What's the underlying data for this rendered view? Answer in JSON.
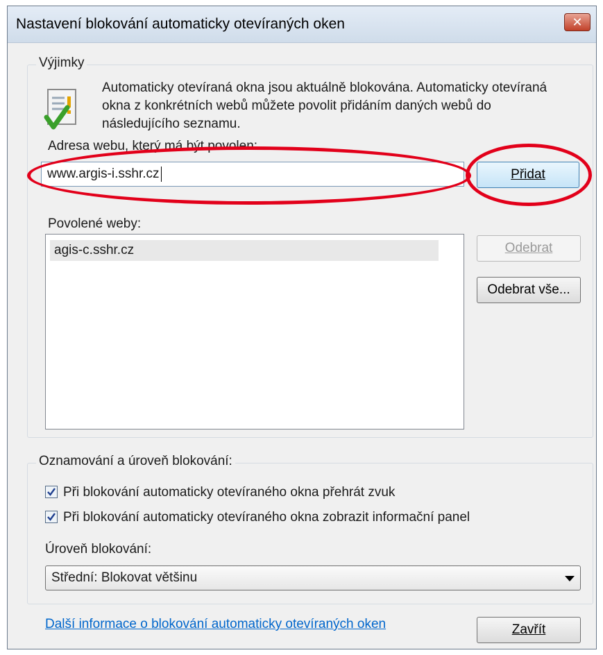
{
  "window": {
    "title": "Nastavení blokování automaticky otevíraných oken",
    "close_label": "✕"
  },
  "exceptions": {
    "legend": "Výjimky",
    "info_text": "Automaticky otevíraná okna jsou aktuálně blokována. Automaticky otevíraná okna z konkrétních webů můžete povolit přidáním daných webů do následujícího seznamu.",
    "address_label": "Adresa webu, který má být povolen:",
    "address_value": "www.argis-i.sshr.cz",
    "add_button": "Přidat",
    "allowed_label": "Povolené weby:",
    "allowed_sites": [
      "agis-c.sshr.cz"
    ],
    "remove_button": "Odebrat",
    "remove_all_button": "Odebrat vše..."
  },
  "notifications": {
    "legend": "Oznamování a úroveň blokování:",
    "sound_label": "Při blokování automaticky otevíraného okna přehrát zvuk",
    "sound_checked": true,
    "infobar_label": "Při blokování automaticky otevíraného okna zobrazit informační panel",
    "infobar_checked": true,
    "level_label": "Úroveň blokování:",
    "level_value": "Střední: Blokovat většinu"
  },
  "footer": {
    "help_link": "Další informace o blokování automaticky otevíraných oken",
    "close_button": "Zavřít"
  },
  "colors": {
    "highlight": "#e2001a",
    "link": "#0066cc"
  }
}
